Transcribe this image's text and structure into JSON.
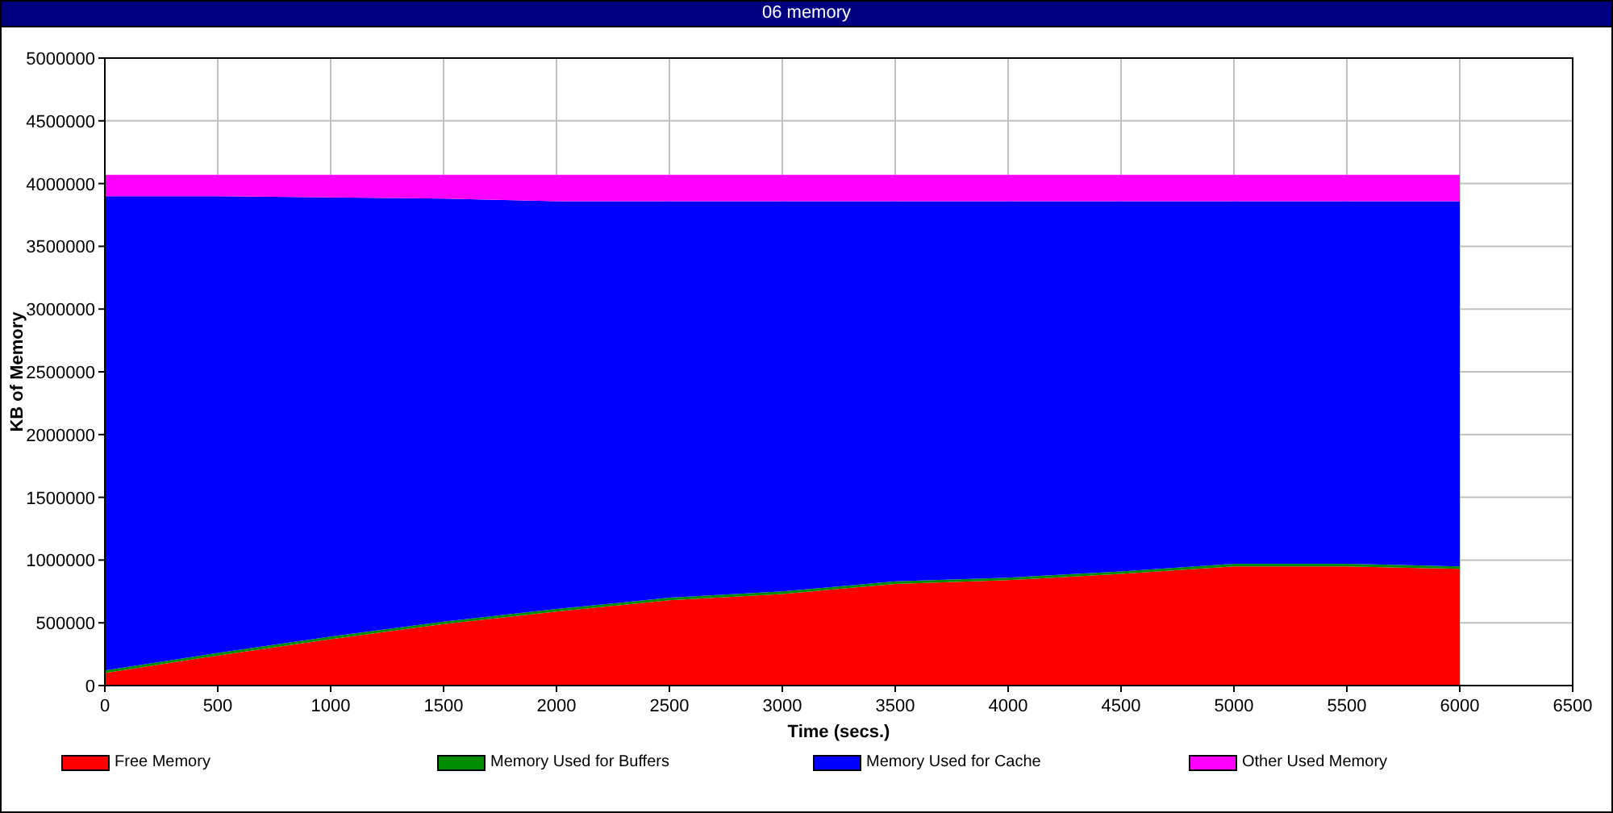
{
  "chart_data": {
    "type": "area",
    "title": "06 memory",
    "xlabel": "Time (secs.)",
    "ylabel": "KB of Memory",
    "stacked": true,
    "x": [
      0,
      500,
      1000,
      1500,
      2000,
      2500,
      3000,
      3500,
      4000,
      4500,
      5000,
      5500,
      6000
    ],
    "series": [
      {
        "name": "Free Memory",
        "color": "#ff0000",
        "values": [
          100000,
          240000,
          370000,
          490000,
          590000,
          680000,
          730000,
          810000,
          840000,
          890000,
          950000,
          950000,
          930000
        ]
      },
      {
        "name": "Memory Used for Buffers",
        "color": "#008c00",
        "values": [
          20000,
          20000,
          20000,
          20000,
          20000,
          20000,
          20000,
          20000,
          20000,
          20000,
          20000,
          20000,
          20000
        ]
      },
      {
        "name": "Memory Used for Cache",
        "color": "#0000ff",
        "values": [
          3780000,
          3640000,
          3500000,
          3370000,
          3250000,
          3160000,
          3110000,
          3030000,
          3000000,
          2950000,
          2890000,
          2890000,
          2910000
        ]
      },
      {
        "name": "Other Used Memory",
        "color": "#ff00ff",
        "values": [
          170000,
          170000,
          180000,
          190000,
          210000,
          210000,
          210000,
          210000,
          210000,
          210000,
          210000,
          210000,
          210000
        ]
      }
    ],
    "xlim": [
      0,
      6500
    ],
    "ylim": [
      0,
      5000000
    ],
    "xticks": [
      0,
      500,
      1000,
      1500,
      2000,
      2500,
      3000,
      3500,
      4000,
      4500,
      5000,
      5500,
      6000,
      6500
    ],
    "yticks": [
      0,
      500000,
      1000000,
      1500000,
      2000000,
      2500000,
      3000000,
      3500000,
      4000000,
      4500000,
      5000000
    ],
    "grid": true,
    "legend": true
  }
}
